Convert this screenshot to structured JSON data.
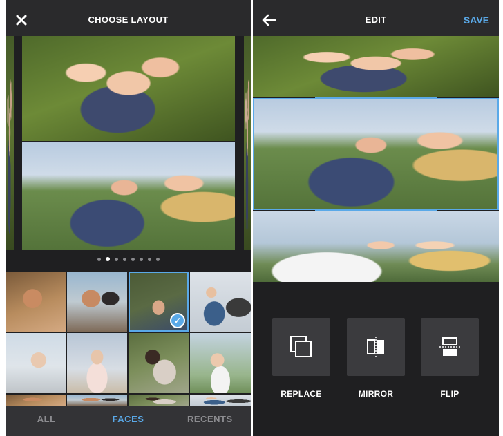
{
  "left_screen": {
    "header": {
      "title": "CHOOSE LAYOUT",
      "close_icon": "close-x-icon"
    },
    "carousel": {
      "page_count": 8,
      "active_page": 2
    },
    "tabs": [
      {
        "label": "ALL",
        "active": false
      },
      {
        "label": "FACES",
        "active": true
      },
      {
        "label": "RECENTS",
        "active": false
      }
    ],
    "selected_thumbnail": 3
  },
  "right_screen": {
    "header": {
      "title": "EDIT",
      "back_icon": "back-arrow-icon",
      "save_label": "SAVE"
    },
    "tools": [
      {
        "label": "REPLACE",
        "icon": "replace-icon"
      },
      {
        "label": "MIRROR",
        "icon": "mirror-icon"
      },
      {
        "label": "FLIP",
        "icon": "flip-icon"
      }
    ]
  },
  "colors": {
    "accent": "#5aa9e8",
    "background": "#1f1f21",
    "panel": "#2a2a2c"
  }
}
